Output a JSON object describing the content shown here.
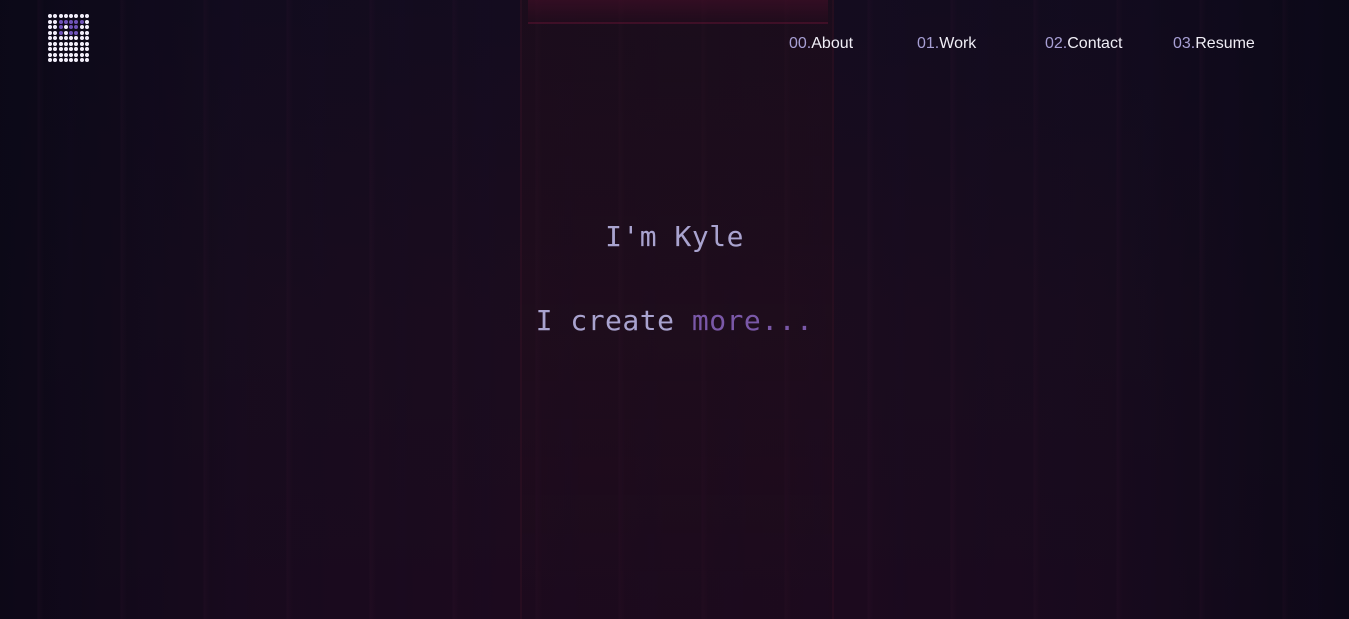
{
  "logo": {
    "icon": "dot-grid-logo-icon"
  },
  "nav": {
    "items": [
      {
        "num": "00.",
        "label": "About"
      },
      {
        "num": "01.",
        "label": "Work"
      },
      {
        "num": "02.",
        "label": "Contact"
      },
      {
        "num": "03.",
        "label": "Resume"
      }
    ]
  },
  "hero": {
    "name": "I'm Kyle",
    "tag_prefix": "I create ",
    "tag_accent": "more..."
  },
  "colors": {
    "background": "#140d1c",
    "nav_text": "#f0eef6",
    "nav_number": "#a79fd4",
    "hero_text": "#a9a3cf",
    "hero_accent": "#7a58a8"
  }
}
